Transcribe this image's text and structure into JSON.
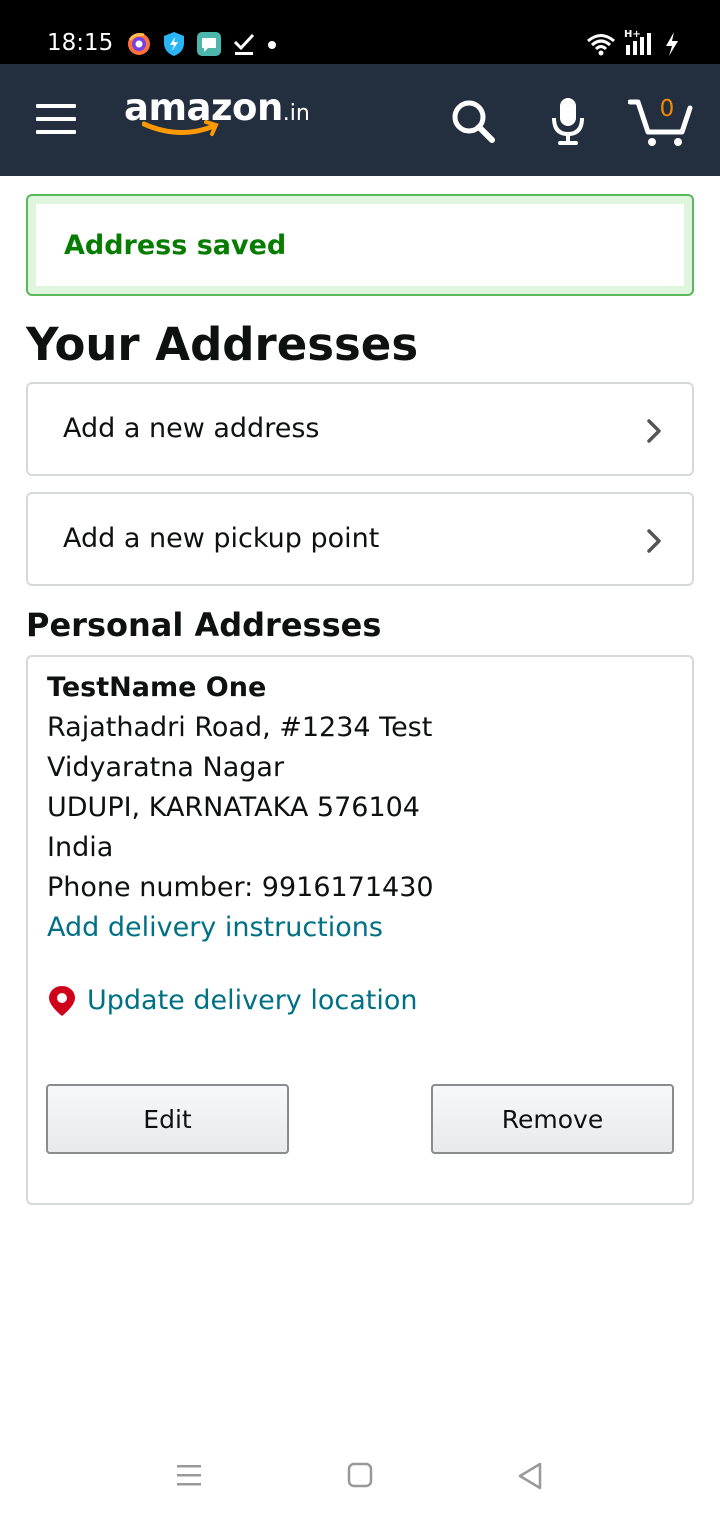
{
  "status_bar": {
    "time": "18:15",
    "left_icons": [
      "firefox-focus-icon",
      "shield-bolt-icon",
      "message-icon",
      "check-download-icon",
      "dot-icon"
    ],
    "right_icons": [
      "wifi-icon",
      "signal-icon",
      "charging-icon"
    ],
    "network_label": "H+"
  },
  "header": {
    "logo_text": "amazon",
    "logo_tld": ".in",
    "cart_count": "0",
    "icons": [
      "menu-icon",
      "search-icon",
      "mic-icon",
      "cart-icon"
    ]
  },
  "alert": {
    "text": "Address saved",
    "color": "#067d00"
  },
  "page_title": "Your Addresses",
  "nav_rows": [
    {
      "label": "Add a new address"
    },
    {
      "label": "Add a new pickup point"
    }
  ],
  "section_title": "Personal Addresses",
  "address": {
    "name": "TestName One",
    "line1": "Rajathadri Road, #1234 Test",
    "line2": "Vidyaratna Nagar",
    "city_line": "UDUPI, KARNATAKA 576104",
    "country": "India",
    "phone": "Phone number: 9916171430",
    "add_instructions_link": "Add delivery instructions",
    "update_location_link": "Update delivery location",
    "edit_label": "Edit",
    "remove_label": "Remove"
  },
  "colors": {
    "header_bg": "#232f3e",
    "link": "#007185",
    "cart_accent": "#f08804",
    "pin": "#d0021b"
  }
}
